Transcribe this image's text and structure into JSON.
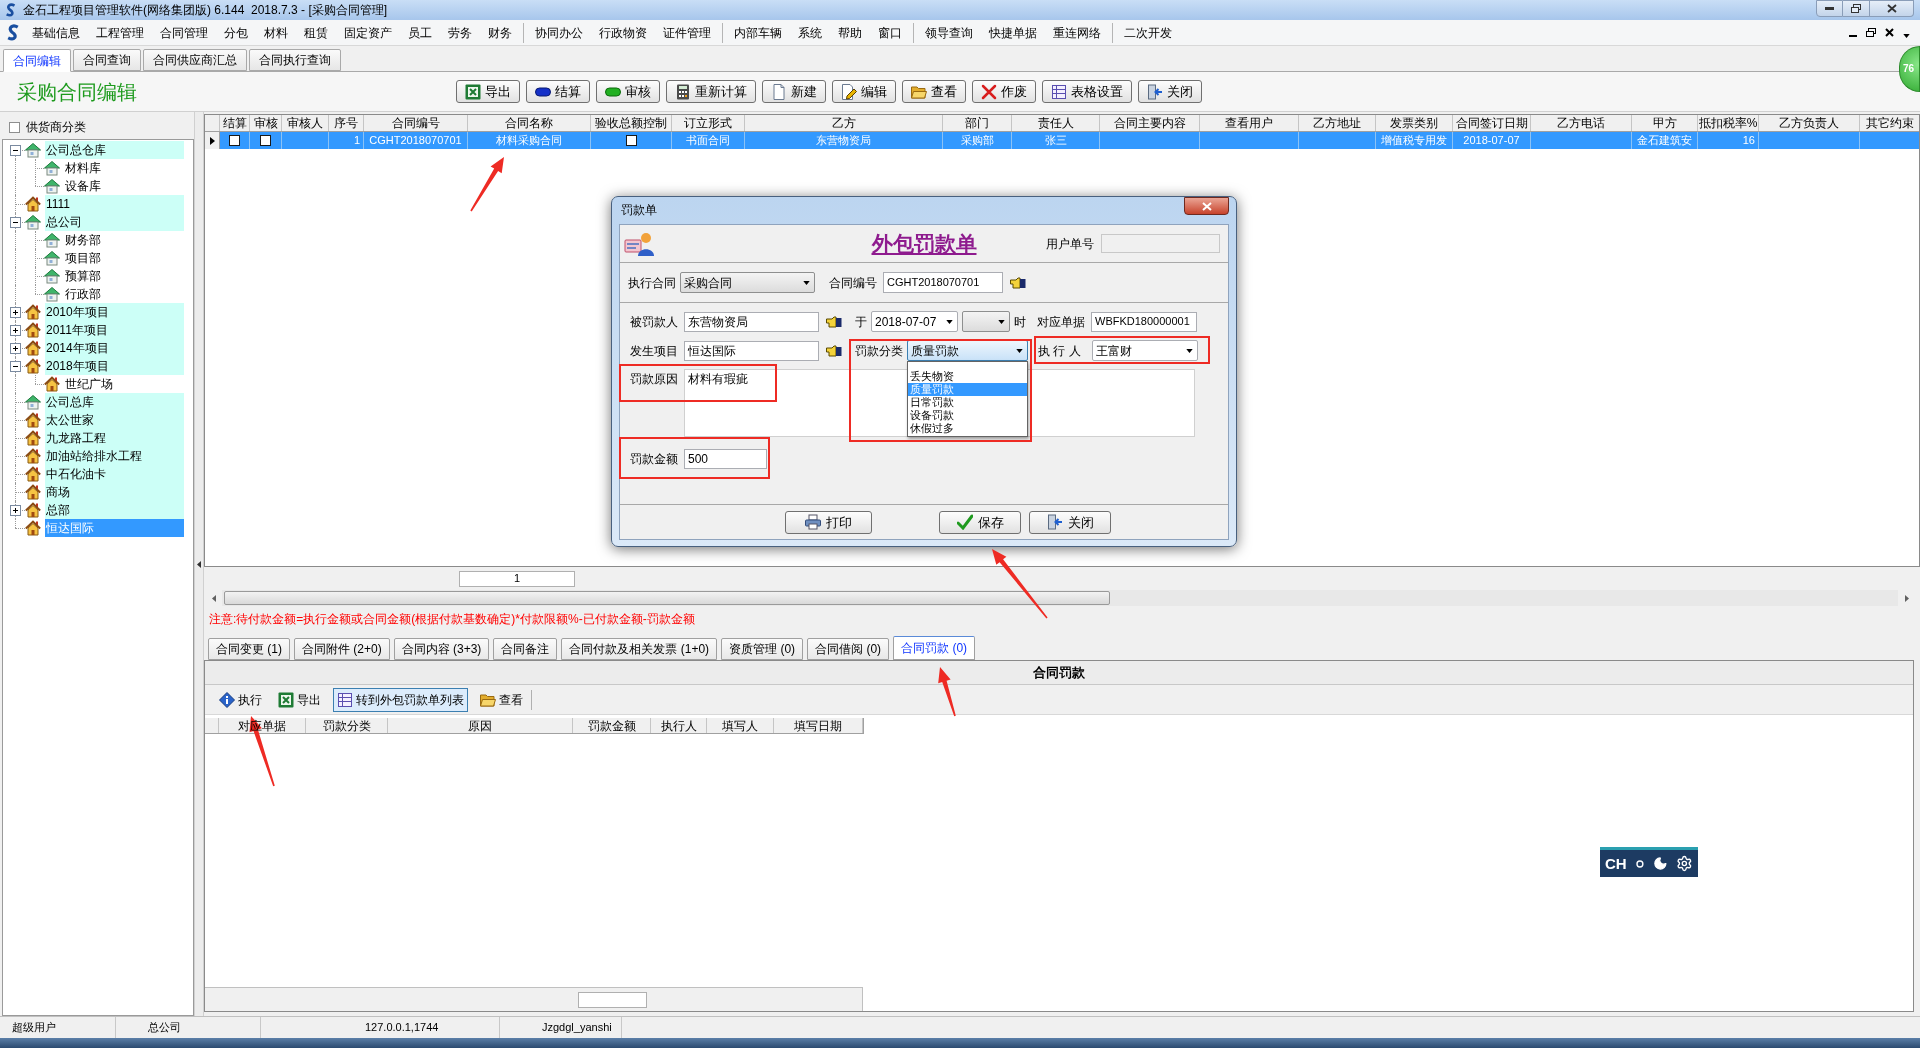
{
  "window": {
    "title": "金石工程项目管理软件(网络集团版) 6.144  2018.7.3 - [采购合同管理]"
  },
  "menu": [
    [
      "基础信息",
      "工程管理",
      "合同管理",
      "分包",
      "材料",
      "租赁",
      "固定资产",
      "员工",
      "劳务",
      "财务"
    ],
    [
      "协同办公",
      "行政物资",
      "证件管理"
    ],
    [
      "内部车辆",
      "系统",
      "帮助",
      "窗口"
    ],
    [
      "领导查询",
      "快捷单据",
      "重连网络"
    ],
    [
      "二次开发"
    ]
  ],
  "module_tabs": [
    {
      "label": "合同编辑",
      "selected": true
    },
    {
      "label": "合同查询",
      "selected": false
    },
    {
      "label": "合同供应商汇总",
      "selected": false
    },
    {
      "label": "合同执行查询",
      "selected": false
    }
  ],
  "page_title": "采购合同编辑",
  "toolbar": [
    {
      "kind": "export",
      "label": "导出"
    },
    {
      "kind": "settle",
      "label": "结算"
    },
    {
      "kind": "approve",
      "label": "审核"
    },
    {
      "kind": "recalc",
      "label": "重新计算"
    },
    {
      "kind": "create",
      "label": "新建"
    },
    {
      "kind": "edit",
      "label": "编辑"
    },
    {
      "kind": "view",
      "label": "查看"
    },
    {
      "kind": "void",
      "label": "作废"
    },
    {
      "kind": "layout",
      "label": "表格设置"
    },
    {
      "kind": "close",
      "label": "关闭"
    }
  ],
  "supplier_tree": {
    "header": {
      "label": "供货商分类",
      "checked": false
    },
    "nodes": [
      {
        "label": "公司总仓库",
        "kind": "store",
        "highlighted": true,
        "selected": false,
        "expanded": true,
        "children": [
          {
            "label": "材料库",
            "kind": "store",
            "highlighted": false,
            "selected": false
          },
          {
            "label": "设备库",
            "kind": "store",
            "highlighted": false,
            "selected": false
          }
        ]
      },
      {
        "label": "1111",
        "kind": "home",
        "highlighted": true,
        "selected": false
      },
      {
        "label": "总公司",
        "kind": "store",
        "highlighted": true,
        "selected": false,
        "expanded": true,
        "children": [
          {
            "label": "财务部",
            "kind": "store",
            "highlighted": false,
            "selected": false
          },
          {
            "label": "项目部",
            "kind": "store",
            "highlighted": false,
            "selected": false
          },
          {
            "label": "预算部",
            "kind": "store",
            "highlighted": false,
            "selected": false
          },
          {
            "label": "行政部",
            "kind": "store",
            "highlighted": false,
            "selected": false
          }
        ]
      },
      {
        "label": "2010年项目",
        "kind": "home",
        "highlighted": true,
        "selected": false,
        "expanded": false
      },
      {
        "label": "2011年项目",
        "kind": "home",
        "highlighted": true,
        "selected": false,
        "expanded": false
      },
      {
        "label": "2014年项目",
        "kind": "home",
        "highlighted": true,
        "selected": false,
        "expanded": false
      },
      {
        "label": "2018年项目",
        "kind": "home",
        "highlighted": true,
        "selected": false,
        "expanded": true,
        "children": [
          {
            "label": "世纪广场",
            "kind": "home",
            "highlighted": false,
            "selected": false
          }
        ]
      },
      {
        "label": "公司总库",
        "kind": "store",
        "highlighted": true,
        "selected": false
      },
      {
        "label": "太公世家",
        "kind": "home",
        "highlighted": true,
        "selected": false
      },
      {
        "label": "九龙路工程",
        "kind": "home",
        "highlighted": true,
        "selected": false
      },
      {
        "label": "加油站给排水工程",
        "kind": "home",
        "highlighted": true,
        "selected": false
      },
      {
        "label": "中石化油卡",
        "kind": "home",
        "highlighted": true,
        "selected": false
      },
      {
        "label": "商场",
        "kind": "home",
        "highlighted": true,
        "selected": false
      },
      {
        "label": "总部",
        "kind": "home",
        "highlighted": true,
        "selected": false,
        "expanded": false
      },
      {
        "label": "恒达国际",
        "kind": "home",
        "highlighted": true,
        "selected": true
      }
    ]
  },
  "contract_table": {
    "columns": [
      "结算",
      "审核",
      "审核人",
      "序号",
      "合同编号",
      "合同名称",
      "验收总额控制",
      "订立形式",
      "乙方",
      "部门",
      "责任人",
      "合同主要内容",
      "查看用户",
      "乙方地址",
      "发票类别",
      "合同签订日期",
      "乙方电话",
      "甲方",
      "抵扣税率%",
      "乙方负责人",
      "其它约束"
    ],
    "rows": [
      {
        "selected": true,
        "cells": [
          {
            "kind": "check",
            "checked": false
          },
          {
            "kind": "check",
            "checked": false
          },
          {
            "kind": "blank"
          },
          {
            "kind": "number",
            "text": "1"
          },
          {
            "kind": "text",
            "text": "CGHT2018070701"
          },
          {
            "kind": "text",
            "text": "材料采购合同"
          },
          {
            "kind": "check",
            "checked": false
          },
          {
            "kind": "text",
            "text": "书面合同"
          },
          {
            "kind": "text",
            "text": "东营物资局"
          },
          {
            "kind": "text",
            "text": "采购部"
          },
          {
            "kind": "text",
            "text": "张三"
          },
          {
            "kind": "blank"
          },
          {
            "kind": "blank"
          },
          {
            "kind": "blank"
          },
          {
            "kind": "text",
            "text": "增值税专用发"
          },
          {
            "kind": "text",
            "text": "2018-07-07"
          },
          {
            "kind": "blank"
          },
          {
            "kind": "text",
            "text": "金石建筑安"
          },
          {
            "kind": "number",
            "text": "16"
          },
          {
            "kind": "blank"
          },
          {
            "kind": "blank"
          }
        ]
      }
    ],
    "page": "1"
  },
  "note": "注意:待付款金额=执行金额或合同金额(根据付款基数确定)*付款限额%-已付款金额-罚款金额",
  "detail_tabs": [
    {
      "label": "合同变更 (1)",
      "selected": false
    },
    {
      "label": "合同附件 (2+0)",
      "selected": false
    },
    {
      "label": "合同内容 (3+3)",
      "selected": false
    },
    {
      "label": "合同备注",
      "selected": false
    },
    {
      "label": "合同付款及相关发票 (1+0)",
      "selected": false
    },
    {
      "label": "资质管理 (0)",
      "selected": false
    },
    {
      "label": "合同借阅 (0)",
      "selected": false
    },
    {
      "label": "合同罚款 (0)",
      "selected": true
    }
  ],
  "penalty_panel": {
    "title": "合同罚款",
    "toolbar": [
      {
        "kind": "execute",
        "label": "执行",
        "pressed": false
      },
      {
        "kind": "export",
        "label": "导出",
        "pressed": false
      },
      {
        "kind": "list",
        "label": "转到外包罚款单列表",
        "pressed": true
      },
      {
        "kind": "view",
        "label": "查看",
        "pressed": false
      }
    ],
    "columns": [
      "对应单据",
      "罚款分类",
      "原因",
      "罚款金额",
      "执行人",
      "填写人",
      "填写日期"
    ]
  },
  "status_bar": [
    "超级用户",
    "总公司",
    "127.0.0.1,1744",
    "Jzgdgl_yanshi"
  ],
  "speed_badge": "76",
  "ime_bar": {
    "mode": "CH"
  },
  "dialog": {
    "title": "罚款单",
    "heading": "外包罚款单",
    "user_no": {
      "label": "用户单号"
    },
    "contract": {
      "label": "执行合同",
      "value": "采购合同"
    },
    "contract_no": {
      "label": "合同编号",
      "value": "CGHT2018070701"
    },
    "penalized": {
      "label": "被罚款人",
      "value": "东营物资局"
    },
    "date": {
      "label": "于",
      "value": "2018-07-07"
    },
    "hour": {
      "label": "时"
    },
    "voucher": {
      "label": "对应单据",
      "value": "WBFKD180000001"
    },
    "project": {
      "label": "发生项目",
      "value": "恒达国际"
    },
    "category": {
      "label": "罚款分类",
      "value": "质量罚款",
      "expanded": true,
      "options": [
        {
          "label": "丢失物资",
          "selected": false
        },
        {
          "label": "质量罚款",
          "selected": true
        },
        {
          "label": "日常罚款",
          "selected": false
        },
        {
          "label": "设备罚款",
          "selected": false
        },
        {
          "label": "休假过多",
          "selected": false
        }
      ]
    },
    "executor": {
      "label": "执 行 人",
      "value": "王富财"
    },
    "reason": {
      "label": "罚款原因",
      "value": "材料有瑕疵"
    },
    "amount": {
      "label": "罚款金额",
      "value": "500"
    },
    "buttons": [
      {
        "kind": "print",
        "label": "打印"
      },
      {
        "kind": "save",
        "label": "保存"
      },
      {
        "kind": "close",
        "label": "关闭"
      }
    ]
  }
}
